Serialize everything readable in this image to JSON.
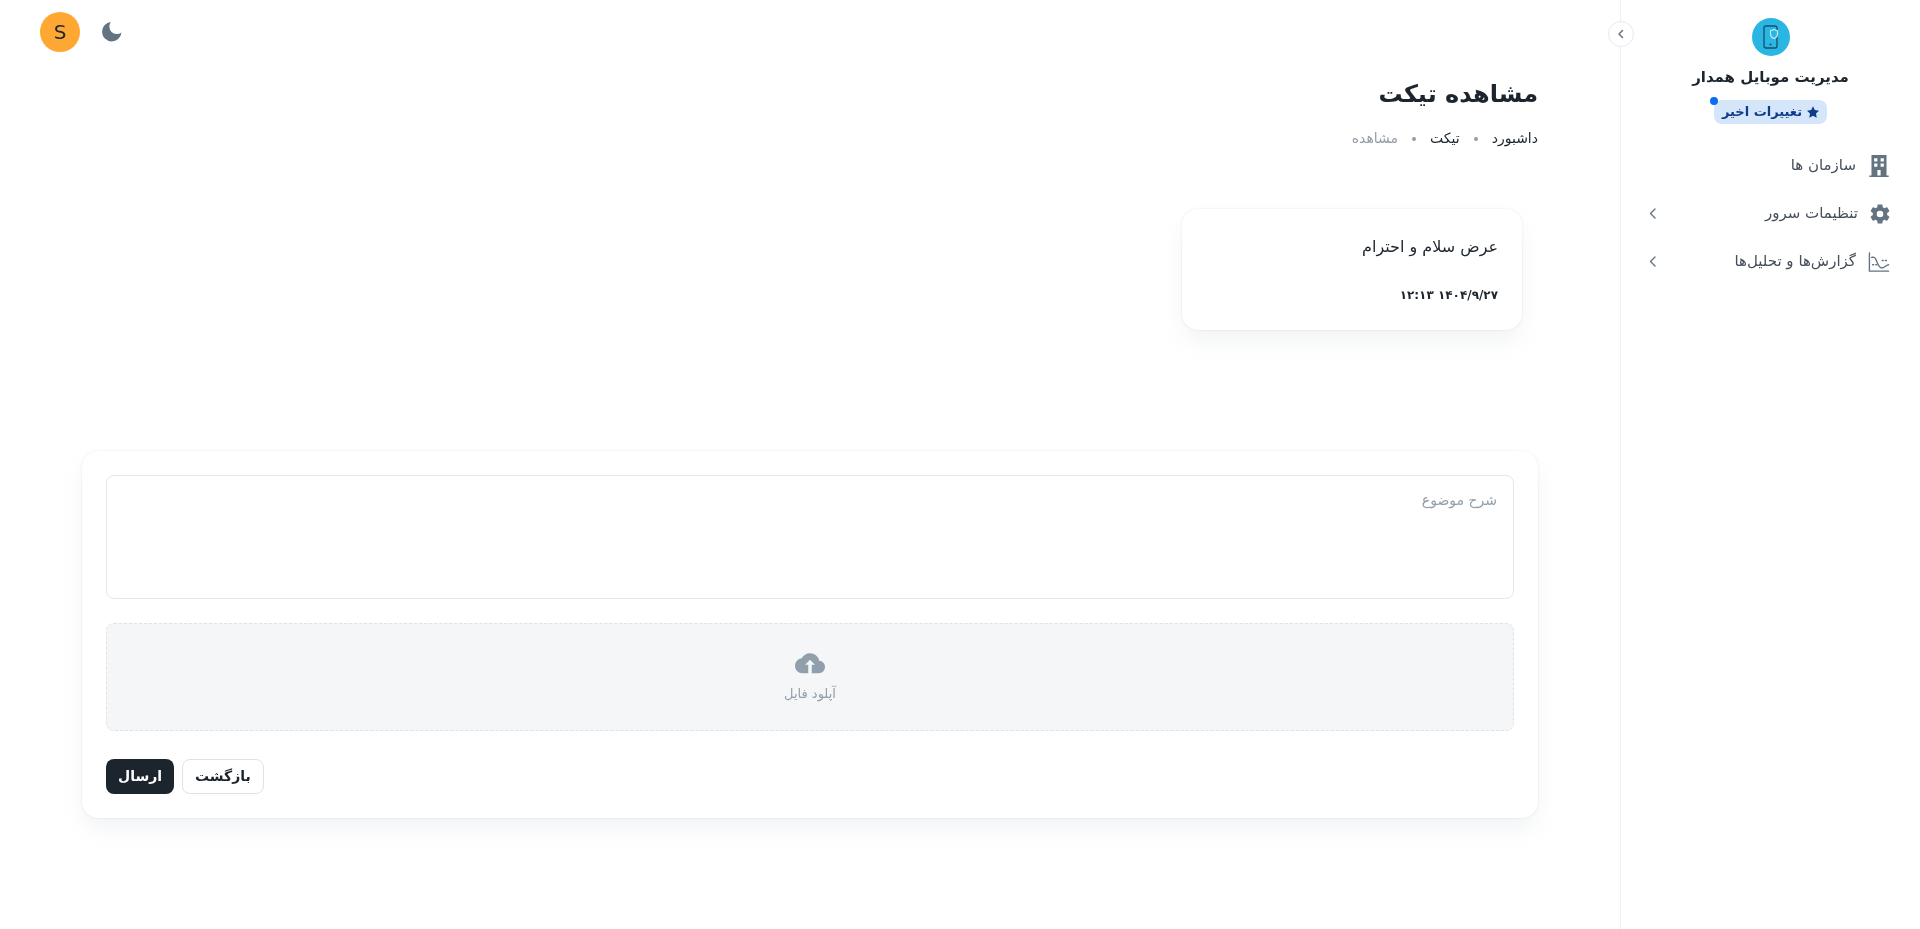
{
  "user": {
    "initial": "S"
  },
  "sidebar": {
    "app_name": "مدیریت موبایل همدار",
    "badge": {
      "label": "تغییرات اخیر",
      "new": true
    },
    "items": [
      {
        "label": "سازمان ها",
        "kind": "link"
      },
      {
        "label": "تنظیمات سرور",
        "kind": "group"
      },
      {
        "label": "گزارش‌ها و تحلیل‌ها",
        "kind": "group"
      }
    ]
  },
  "page": {
    "title": "مشاهده تیکت",
    "breadcrumb": [
      {
        "label": "داشبورد",
        "current": false
      },
      {
        "label": "تیکت",
        "current": false
      },
      {
        "label": "مشاهده",
        "current": true
      }
    ]
  },
  "messages": [
    {
      "text": "عرض سلام و احترام",
      "time": "۱۴۰۴/۹/۲۷ ۱۲:۱۳"
    }
  ],
  "reply_form": {
    "description": {
      "placeholder": "شرح موضوع"
    },
    "upload": {
      "label": "آپلود فایل"
    },
    "buttons": [
      {
        "label": "بازگشت",
        "kind": "secondary"
      },
      {
        "label": "ارسال",
        "kind": "primary"
      }
    ]
  }
}
